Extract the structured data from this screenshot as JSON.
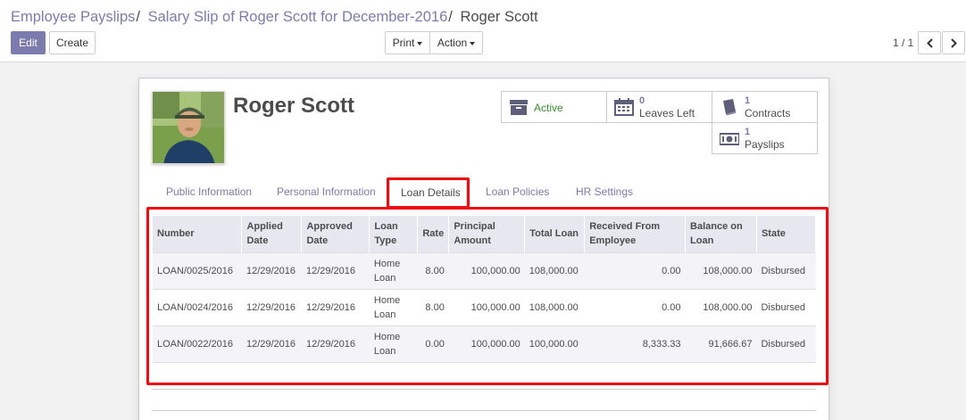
{
  "breadcrumb": {
    "items": [
      "Employee Payslips",
      "Salary Slip of Roger Scott for December-2016"
    ],
    "separator": "/",
    "current": "Roger Scott"
  },
  "buttons": {
    "edit": "Edit",
    "create": "Create",
    "print": "Print",
    "action": "Action"
  },
  "pager": {
    "value": "1 / 1"
  },
  "employee": {
    "name": "Roger Scott"
  },
  "smart_buttons": {
    "active": {
      "label": "Active",
      "icon": "archive-icon"
    },
    "leaves": {
      "count": "0",
      "label": "Leaves Left",
      "icon": "calendar-icon"
    },
    "contracts": {
      "count": "1",
      "label": "Contracts",
      "icon": "book-icon"
    },
    "payslips": {
      "count": "1",
      "label": "Payslips",
      "icon": "money-icon"
    }
  },
  "tabs": [
    "Public Information",
    "Personal Information",
    "Loan Details",
    "Loan Policies",
    "HR Settings"
  ],
  "active_tab": "Loan Details",
  "loans": {
    "columns": [
      "Number",
      "Applied Date",
      "Approved Date",
      "Loan Type",
      "Rate",
      "Principal Amount",
      "Total Loan",
      "Received From Employee",
      "Balance on Loan",
      "State"
    ],
    "rows": [
      {
        "number": "LOAN/0025/2016",
        "applied": "12/29/2016",
        "approved": "12/29/2016",
        "type": "Home Loan",
        "rate": "8.00",
        "principal": "100,000.00",
        "total": "108,000.00",
        "received": "0.00",
        "balance": "108,000.00",
        "state": "Disbursed"
      },
      {
        "number": "LOAN/0024/2016",
        "applied": "12/29/2016",
        "approved": "12/29/2016",
        "type": "Home Loan",
        "rate": "8.00",
        "principal": "100,000.00",
        "total": "108,000.00",
        "received": "0.00",
        "balance": "108,000.00",
        "state": "Disbursed"
      },
      {
        "number": "LOAN/0022/2016",
        "applied": "12/29/2016",
        "approved": "12/29/2016",
        "type": "Home Loan",
        "rate": "0.00",
        "principal": "100,000.00",
        "total": "100,000.00",
        "received": "8,333.33",
        "balance": "91,666.67",
        "state": "Disbursed"
      }
    ]
  },
  "colors": {
    "accent": "#7c7bad",
    "active_green": "#3c8d2e",
    "highlight_red": "#ee0b11",
    "header_bg": "#e7e7f0"
  }
}
